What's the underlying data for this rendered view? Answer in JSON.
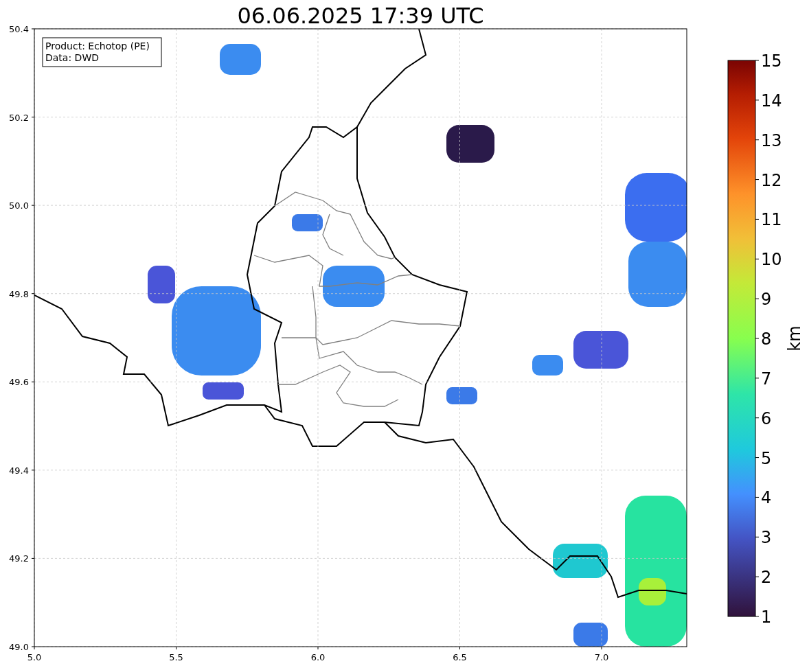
{
  "title": "06.06.2025 17:39 UTC",
  "info_box": {
    "lines": [
      "Product: Echotop (PE)",
      "Data: DWD"
    ]
  },
  "map": {
    "xticks": [
      "5.0",
      "5.5",
      "6.0",
      "6.5",
      "7.0"
    ],
    "yticks": [
      "50.4",
      "50.2",
      "50.0",
      "49.8",
      "49.6",
      "49.4",
      "49.2",
      "49.0"
    ]
  },
  "colorbar": {
    "label": "km",
    "ticks": [
      "15",
      "14",
      "13",
      "12",
      "11",
      "10",
      "9",
      "8",
      "7",
      "6",
      "5",
      "4",
      "3",
      "2",
      "1"
    ]
  }
}
